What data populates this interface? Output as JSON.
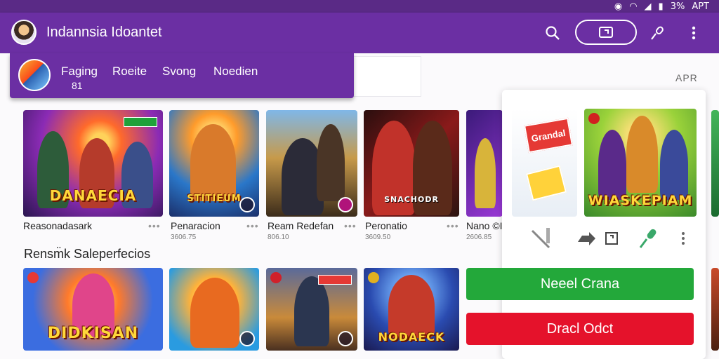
{
  "status_bar": {
    "right_text": "APT",
    "battery_text": "3%"
  },
  "header": {
    "title": "Indannsia Idoantet"
  },
  "tabs": {
    "items": [
      {
        "label": "Faging"
      },
      {
        "label": "Roeite"
      },
      {
        "label": "Svong"
      },
      {
        "label": "Noedien"
      }
    ],
    "count": "81"
  },
  "corner_label": "APR",
  "row1": [
    {
      "title": "Reasonadasark",
      "sub": "",
      "logo": "DANAECIA"
    },
    {
      "title": "Penaracion",
      "sub": "3606.75",
      "logo": "STITIEUM"
    },
    {
      "title": "Ream Redefan",
      "sub": "806.10",
      "logo": ""
    },
    {
      "title": "Peronatio",
      "sub": "3609.50",
      "logo": "SNACHODR"
    },
    {
      "title": "Nano ©I",
      "sub": "2606.85",
      "logo": ""
    }
  ],
  "section": {
    "title": "Rensm̈k Saleperfecios"
  },
  "row2": [
    {
      "logo": "DIDKISAN"
    },
    {
      "logo": ""
    },
    {
      "logo": ""
    },
    {
      "logo": "NODAECK"
    }
  ],
  "overlay": {
    "banner_text": "Grandal",
    "poster_logo": "WIASKEPIAM"
  },
  "actions": {
    "primary": "Neeel Crana",
    "secondary": "Dracl Odct"
  },
  "colors": {
    "primary_purple": "#6b2fa3",
    "green": "#23a83a",
    "red": "#e5122b"
  }
}
